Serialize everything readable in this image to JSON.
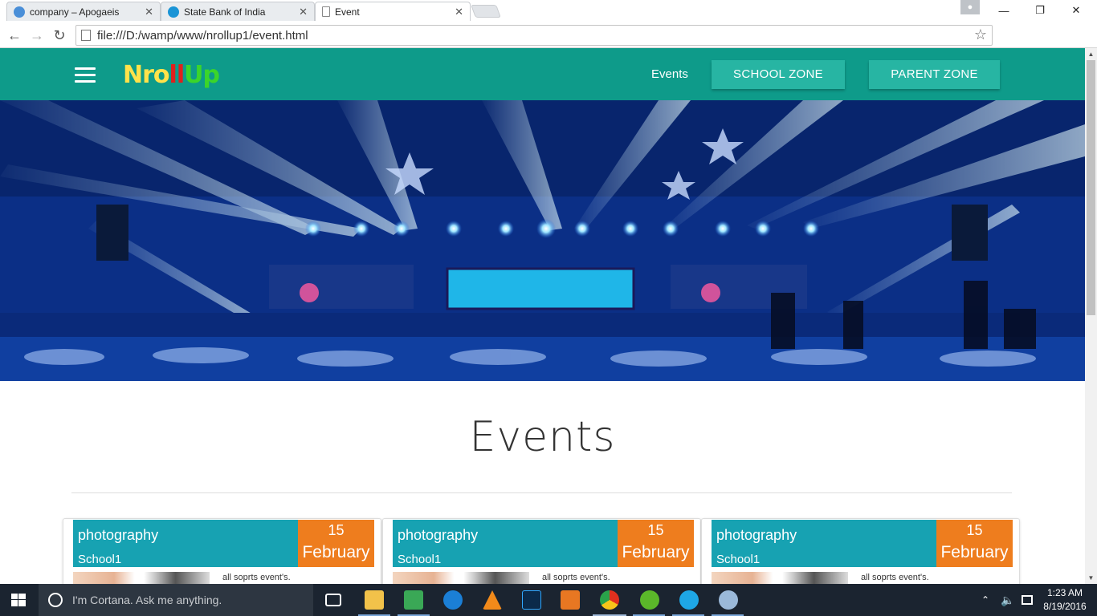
{
  "browser": {
    "tabs": [
      {
        "title": "company – Apogaeis",
        "icon": "apogaeis-favicon",
        "color": "#4a8fd8"
      },
      {
        "title": "State Bank of India",
        "icon": "sbi-favicon",
        "color": "#1a94d6"
      },
      {
        "title": "Event",
        "icon": "page-icon",
        "color": "#ffffff"
      }
    ],
    "close_glyph": "✕",
    "url": "file:///D:/wamp/www/nrollup1/event.html",
    "window_controls": {
      "minimize": "—",
      "maximize": "❐",
      "close": "✕"
    },
    "nav": {
      "back": "←",
      "forward": "→",
      "reload": "↻"
    },
    "star": "☆"
  },
  "site": {
    "logo": {
      "letters": [
        "N",
        "r",
        "o",
        "l",
        "l",
        "U",
        "p"
      ],
      "colors": [
        "#ffe24a",
        "#ffe24a",
        "#ffe24a",
        "#e0201c",
        "#e0201c",
        "#3bd52a",
        "#3bd52a"
      ]
    },
    "nav": {
      "events": "Events",
      "school_zone": "SCHOOL ZONE",
      "parent_zone": "PARENT ZONE"
    },
    "colors": {
      "header": "#0e9b8a",
      "button": "#27b5a3",
      "card_band": "#17a2b2",
      "date_badge": "#ee7d1e"
    }
  },
  "main": {
    "title": "Events",
    "cards": [
      {
        "name": "photography",
        "school": "School1",
        "day": "15",
        "month": "February",
        "description": "all soprts event's."
      },
      {
        "name": "photography",
        "school": "School1",
        "day": "15",
        "month": "February",
        "description": "all soprts event's."
      },
      {
        "name": "photography",
        "school": "School1",
        "day": "15",
        "month": "February",
        "description": "all soprts event's."
      }
    ]
  },
  "taskbar": {
    "search_placeholder": "I'm Cortana. Ask me anything.",
    "time": "1:23 AM",
    "date": "8/19/2016",
    "apps": [
      "task-view-icon",
      "file-explorer-icon",
      "spreadsheet-icon",
      "edge-icon",
      "vlc-icon",
      "photoshop-icon",
      "media-player-icon",
      "chrome-icon",
      "utorrent-icon",
      "skype-icon",
      "paint-icon"
    ]
  }
}
